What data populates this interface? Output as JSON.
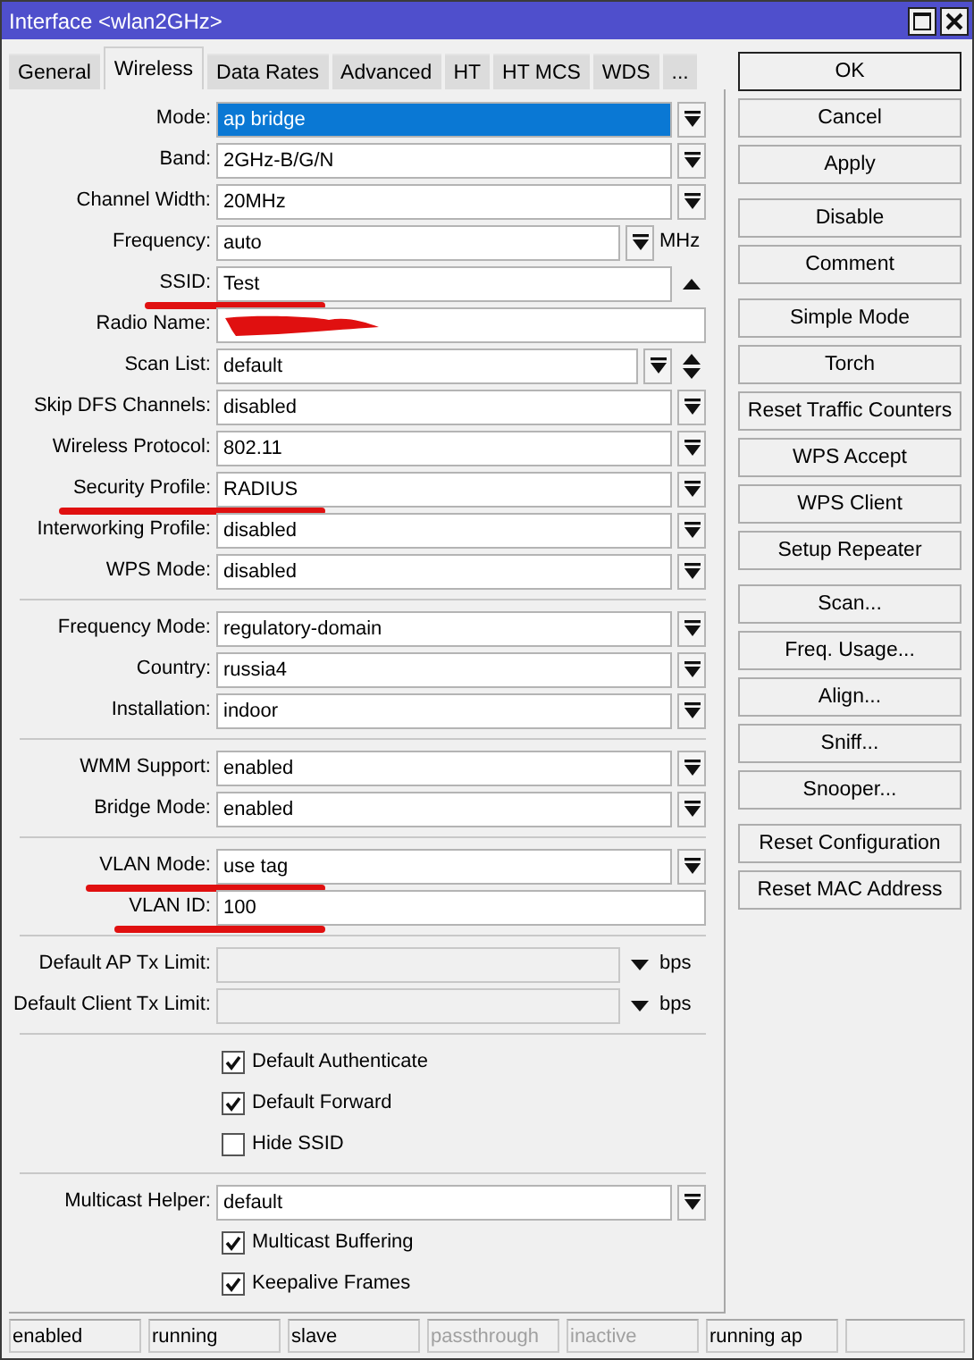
{
  "window": {
    "title": "Interface <wlan2GHz>"
  },
  "tabs": [
    {
      "label": "General",
      "selected": false
    },
    {
      "label": "Wireless",
      "selected": true
    },
    {
      "label": "Data Rates",
      "selected": false
    },
    {
      "label": "Advanced",
      "selected": false
    },
    {
      "label": "HT",
      "selected": false
    },
    {
      "label": "HT MCS",
      "selected": false
    },
    {
      "label": "WDS",
      "selected": false
    },
    {
      "label": "...",
      "selected": false
    }
  ],
  "sections": [
    [
      {
        "kind": "select",
        "label": "Mode:",
        "value": "ap bridge",
        "highlighted": true,
        "marked": false
      },
      {
        "kind": "select",
        "label": "Band:",
        "value": "2GHz-B/G/N",
        "highlighted": false,
        "marked": false
      },
      {
        "kind": "select",
        "label": "Channel Width:",
        "value": "20MHz",
        "highlighted": false,
        "marked": false
      },
      {
        "kind": "select-unit",
        "label": "Frequency:",
        "value": "auto",
        "unit": "MHz",
        "marked": false
      },
      {
        "kind": "text-toggle",
        "label": "SSID:",
        "value": "Test",
        "marked": true
      },
      {
        "kind": "text",
        "label": "Radio Name:",
        "redacted": true,
        "marked": false
      },
      {
        "kind": "select-spin",
        "label": "Scan List:",
        "value": "default",
        "marked": false
      },
      {
        "kind": "select",
        "label": "Skip DFS Channels:",
        "value": "disabled",
        "highlighted": false,
        "marked": false
      },
      {
        "kind": "select",
        "label": "Wireless Protocol:",
        "value": "802.11",
        "highlighted": false,
        "marked": false
      },
      {
        "kind": "select",
        "label": "Security Profile:",
        "value": "RADIUS",
        "highlighted": false,
        "marked": true
      },
      {
        "kind": "select",
        "label": "Interworking Profile:",
        "value": "disabled",
        "highlighted": false,
        "marked": false
      },
      {
        "kind": "select",
        "label": "WPS Mode:",
        "value": "disabled",
        "highlighted": false,
        "marked": false
      }
    ],
    [
      {
        "kind": "select",
        "label": "Frequency Mode:",
        "value": "regulatory-domain",
        "highlighted": false,
        "marked": false
      },
      {
        "kind": "select",
        "label": "Country:",
        "value": "russia4",
        "highlighted": false,
        "marked": false
      },
      {
        "kind": "select",
        "label": "Installation:",
        "value": "indoor",
        "highlighted": false,
        "marked": false
      }
    ],
    [
      {
        "kind": "select",
        "label": "WMM Support:",
        "value": "enabled",
        "highlighted": false,
        "marked": false
      },
      {
        "kind": "select",
        "label": "Bridge Mode:",
        "value": "enabled",
        "highlighted": false,
        "marked": false
      }
    ],
    [
      {
        "kind": "select",
        "label": "VLAN Mode:",
        "value": "use tag",
        "highlighted": false,
        "marked": true
      },
      {
        "kind": "text",
        "label": "VLAN ID:",
        "value": "100",
        "marked": true
      }
    ],
    [
      {
        "kind": "limit",
        "label": "Default AP Tx Limit:",
        "unit": "bps",
        "marked": false
      },
      {
        "kind": "limit",
        "label": "Default Client Tx Limit:",
        "unit": "bps",
        "marked": false
      }
    ],
    [
      {
        "kind": "checkbox",
        "label": "Default Authenticate",
        "checked": true
      },
      {
        "kind": "checkbox",
        "label": "Default Forward",
        "checked": true
      },
      {
        "kind": "checkbox",
        "label": "Hide SSID",
        "checked": false
      }
    ],
    [
      {
        "kind": "select",
        "label": "Multicast Helper:",
        "value": "default",
        "highlighted": false,
        "marked": false
      },
      {
        "kind": "checkbox",
        "label": "Multicast Buffering",
        "checked": true
      },
      {
        "kind": "checkbox",
        "label": "Keepalive Frames",
        "checked": true
      }
    ]
  ],
  "buttons": [
    [
      {
        "label": "OK",
        "default": true
      },
      {
        "label": "Cancel",
        "default": false
      },
      {
        "label": "Apply",
        "default": false
      }
    ],
    [
      {
        "label": "Disable",
        "default": false
      },
      {
        "label": "Comment",
        "default": false
      }
    ],
    [
      {
        "label": "Simple Mode",
        "default": false
      },
      {
        "label": "Torch",
        "default": false
      },
      {
        "label": "Reset Traffic Counters",
        "default": false
      },
      {
        "label": "WPS Accept",
        "default": false
      },
      {
        "label": "WPS Client",
        "default": false
      },
      {
        "label": "Setup Repeater",
        "default": false
      }
    ],
    [
      {
        "label": "Scan...",
        "default": false
      },
      {
        "label": "Freq. Usage...",
        "default": false
      },
      {
        "label": "Align...",
        "default": false
      },
      {
        "label": "Sniff...",
        "default": false
      },
      {
        "label": "Snooper...",
        "default": false
      }
    ],
    [
      {
        "label": "Reset Configuration",
        "default": false
      },
      {
        "label": "Reset MAC Address",
        "default": false
      }
    ]
  ],
  "status_bar": [
    {
      "text": "enabled",
      "disabled": false
    },
    {
      "text": "running",
      "disabled": false
    },
    {
      "text": "slave",
      "disabled": false
    },
    {
      "text": "passthrough",
      "disabled": true
    },
    {
      "text": "inactive",
      "disabled": true
    },
    {
      "text": "running ap",
      "disabled": false
    }
  ]
}
